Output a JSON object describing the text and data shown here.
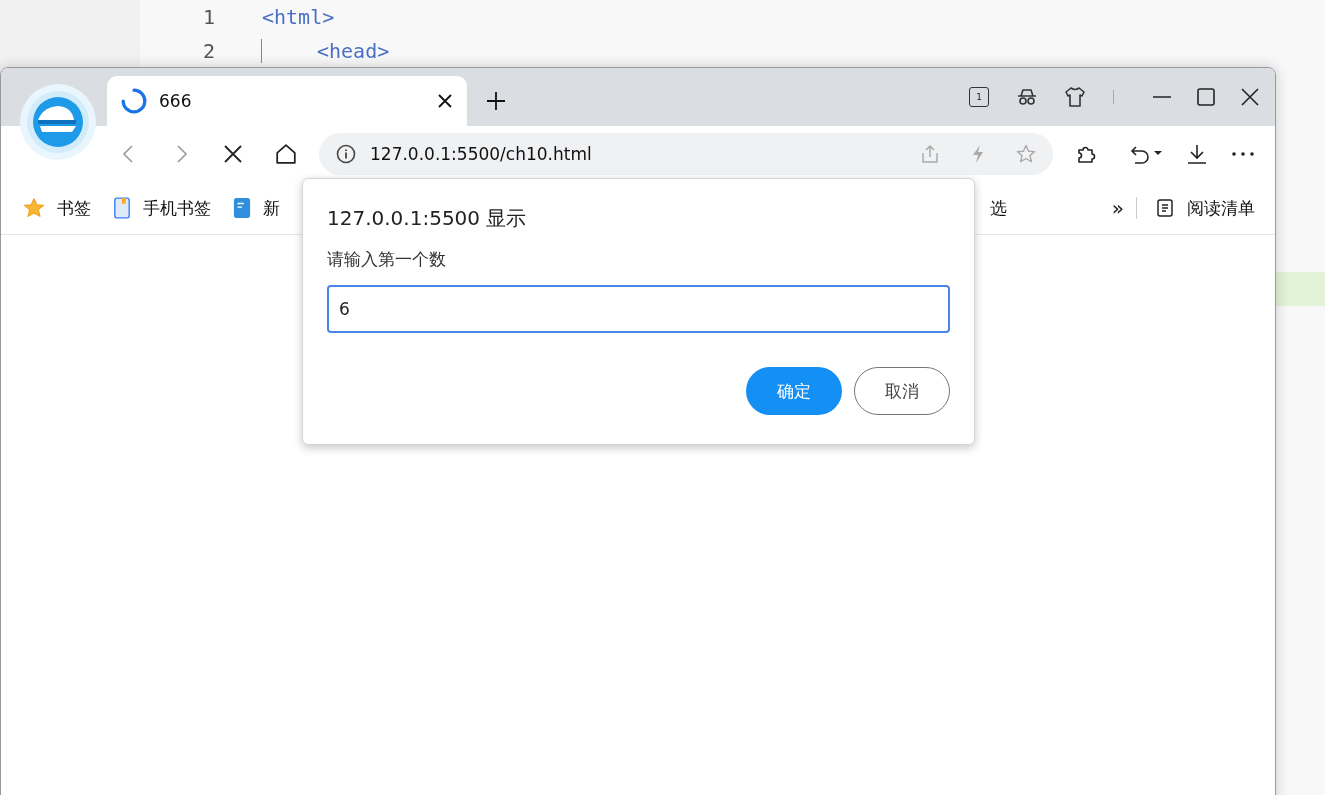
{
  "editor": {
    "lines": [
      {
        "number": "1",
        "code": "<html>",
        "indent": false
      },
      {
        "number": "2",
        "code": "<head>",
        "indent": true
      }
    ]
  },
  "browser": {
    "tab": {
      "title": "666",
      "loading": true
    },
    "tab_count": "1",
    "address": "127.0.0.1:5500/ch10.html",
    "bookmarks": [
      {
        "label": "书签",
        "kind": "star"
      },
      {
        "label": "手机书签",
        "kind": "phone"
      },
      {
        "label": "新",
        "kind": "doc"
      }
    ],
    "bookmark_right": "选",
    "overflow": "»",
    "reading_list": "阅读清单"
  },
  "dialog": {
    "title": "127.0.0.1:5500 显示",
    "message": "请输入第一个数",
    "value": "6",
    "buttons": [
      {
        "label": "确定",
        "kind": "primary"
      },
      {
        "label": "取消",
        "kind": "secondary"
      }
    ]
  }
}
